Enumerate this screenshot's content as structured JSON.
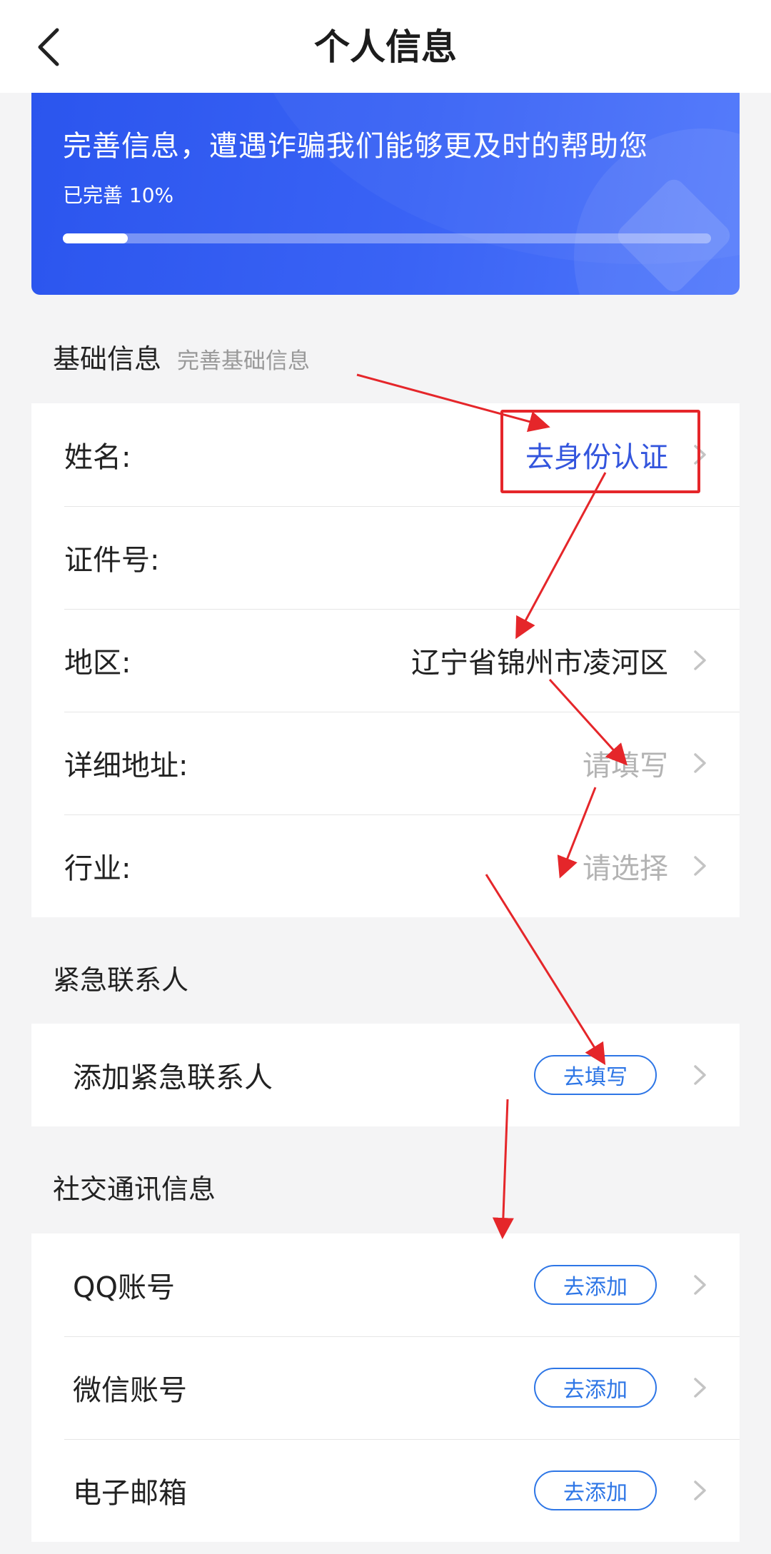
{
  "navbar": {
    "title": "个人信息",
    "back_icon": "chevron-left-icon"
  },
  "banner": {
    "headline": "完善信息，遭遇诈骗我们能够更及时的帮助您",
    "progress_text": "已完善 10%",
    "progress_value": 0.1
  },
  "basic": {
    "title": "基础信息",
    "subtitle": "完善基础信息",
    "rows": [
      {
        "label": "姓名:",
        "value": "去身份认证"
      },
      {
        "label": "证件号:",
        "value": ""
      },
      {
        "label": "地区:",
        "value": "辽宁省锦州市凌河区"
      },
      {
        "label": "详细地址:",
        "value": "请填写"
      },
      {
        "label": "行业:",
        "value": "请选择"
      }
    ]
  },
  "emergency": {
    "title": "紧急联系人",
    "rows": [
      {
        "label": "添加紧急联系人",
        "button": "去填写"
      }
    ]
  },
  "social": {
    "title": "社交通讯信息",
    "rows": [
      {
        "label": "QQ账号",
        "button": "去添加"
      },
      {
        "label": "微信账号",
        "button": "去添加"
      },
      {
        "label": "电子邮箱",
        "button": "去添加"
      }
    ]
  },
  "colors": {
    "accent": "#3355dd",
    "button_blue": "#2e76e6",
    "banner_blue": "#3a63f5",
    "annotation_red": "#e5262a"
  }
}
